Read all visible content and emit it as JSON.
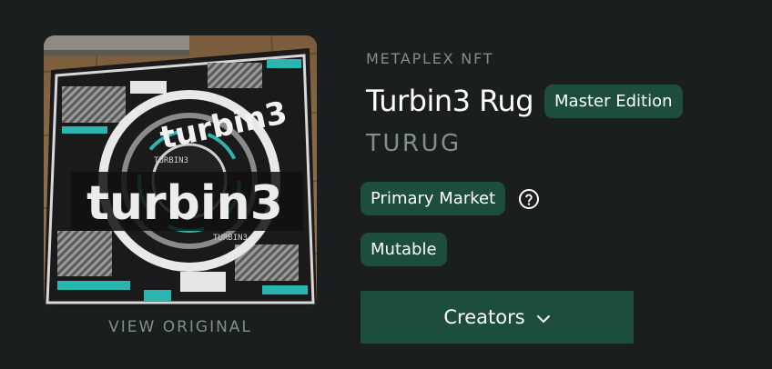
{
  "image": {
    "icon": "nft-rug-artwork",
    "rug_text": "turbin3",
    "rug_small_text_1": "TURBIN3",
    "rug_small_text_2": "TURBIN3",
    "view_original_label": "VIEW ORIGINAL"
  },
  "details": {
    "eyebrow": "METAPLEX NFT",
    "name": "Turbin3 Rug",
    "edition_badge": "Master Edition",
    "symbol": "TURUG",
    "market_badge": "Primary Market",
    "help_icon": "question-circle-icon",
    "mutable_badge": "Mutable",
    "creators_button": "Creators",
    "creators_icon": "chevron-down-icon"
  },
  "colors": {
    "background": "#1a1e1e",
    "accent": "#1c4d3d",
    "muted_text": "#7f908b",
    "text": "#ffffff",
    "rug_teal": "#2bb5b0"
  }
}
